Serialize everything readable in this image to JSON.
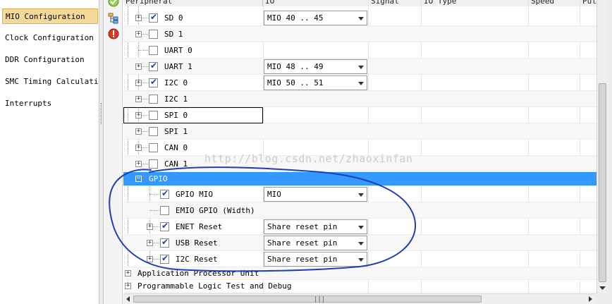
{
  "nav": {
    "items": [
      {
        "label": "MIO Configuration",
        "selected": true
      },
      {
        "label": "Clock Configuration",
        "selected": false
      },
      {
        "label": "DDR Configuration",
        "selected": false
      },
      {
        "label": "SMC Timing Calculation",
        "selected": false
      },
      {
        "label": "Interrupts",
        "selected": false
      }
    ]
  },
  "grid": {
    "columns": [
      "Peripheral",
      "IO",
      "Signal",
      "IO Type",
      "Speed",
      "Pul"
    ],
    "rows": [
      {
        "label": "SD 0",
        "checked": true,
        "io": "MIO 40 .. 45"
      },
      {
        "label": "SD 1",
        "checked": false,
        "io": ""
      },
      {
        "label": "UART 0",
        "checked": false,
        "io": ""
      },
      {
        "label": "UART 1",
        "checked": true,
        "io": "MIO 48 .. 49"
      },
      {
        "label": "I2C 0",
        "checked": true,
        "io": "MIO 50 .. 51"
      },
      {
        "label": "I2C 1",
        "checked": false,
        "io": ""
      },
      {
        "label": "SPI 0",
        "checked": false,
        "io": ""
      },
      {
        "label": "SPI 1",
        "checked": false,
        "io": ""
      },
      {
        "label": "CAN 0",
        "checked": false,
        "io": ""
      },
      {
        "label": "CAN 1",
        "checked": false,
        "io": ""
      },
      {
        "label": "GPIO",
        "checked": null,
        "io": ""
      },
      {
        "label": "GPIO MIO",
        "checked": true,
        "io": "MIO"
      },
      {
        "label": "EMIO GPIO (Width)",
        "checked": false,
        "io": ""
      },
      {
        "label": "ENET Reset",
        "checked": true,
        "io": "Share reset pin"
      },
      {
        "label": "USB Reset",
        "checked": true,
        "io": "Share reset pin"
      },
      {
        "label": "I2C Reset",
        "checked": true,
        "io": "Share reset pin"
      },
      {
        "label": "Application Processor Unit",
        "checked": null,
        "io": ""
      },
      {
        "label": "Programmable Logic Test and Debug",
        "checked": null,
        "io": ""
      }
    ]
  },
  "watermark": "http://blog.csdn.net/zhaoxinfan",
  "colors": {
    "selection": "#3399ff",
    "nav_selected": "#f6d89a",
    "annotation": "#1f3fb0",
    "check": "#1a44a8"
  }
}
